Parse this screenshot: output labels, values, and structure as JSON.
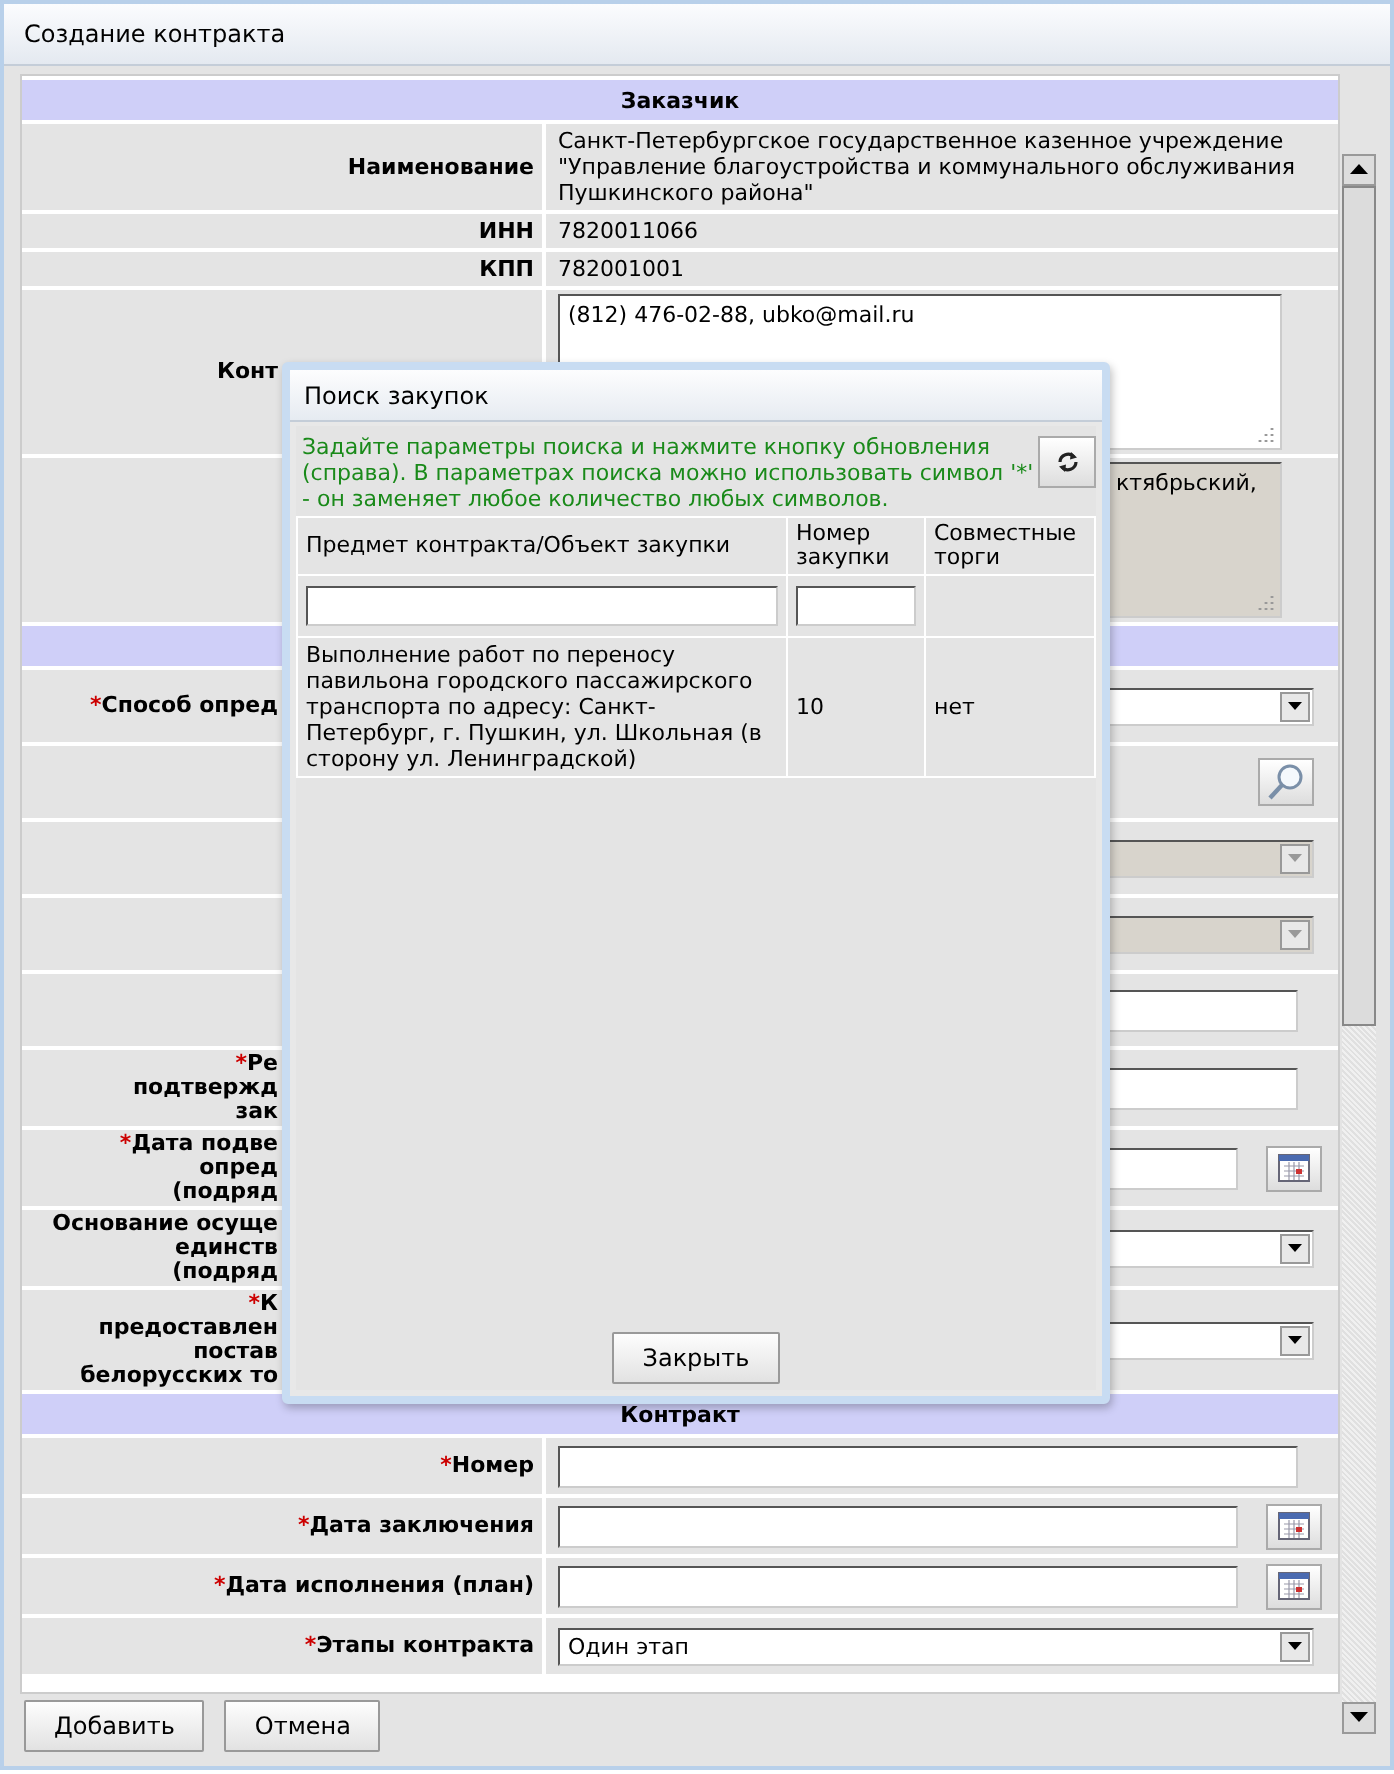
{
  "window": {
    "title": "Создание контракта"
  },
  "required_symbol": "*",
  "sections": [
    {
      "title": "Заказчик",
      "rows": [
        {
          "kind": "text",
          "label": "Наименование",
          "required": false,
          "value": "Санкт-Петербургское государственное казенное учреждение \"Управление благоустройства и коммунального обслуживания Пушкинского района\""
        },
        {
          "kind": "text",
          "label": "ИНН",
          "required": false,
          "value": "7820011066"
        },
        {
          "kind": "text",
          "label": "КПП",
          "required": false,
          "value": "782001001"
        },
        {
          "kind": "textarea",
          "label": "Конт",
          "required": false,
          "cut": true,
          "disabled": false,
          "value": "(812) 476-02-88, ubko@mail.ru"
        },
        {
          "kind": "textarea",
          "required": false,
          "cut": true,
          "disabled": true,
          "value": "ктябрьский,"
        }
      ]
    },
    {
      "rows": [
        {
          "kind": "select",
          "label": "Способ опред",
          "required": true,
          "cut": true,
          "disabled": false
        },
        {
          "kind": "search",
          "required": false
        },
        {
          "kind": "select",
          "required": false,
          "disabled": true
        },
        {
          "kind": "select",
          "required": false,
          "disabled": true
        },
        {
          "kind": "input",
          "required": false
        },
        {
          "kind": "input",
          "label": "Ре\nподтвержд\nзак",
          "required": true,
          "cut": true
        },
        {
          "kind": "date",
          "label": "Дата подве\nопред\n(подряд",
          "required": true,
          "cut": true
        },
        {
          "kind": "select",
          "label": "Основание осуще\nединств\n(подряд",
          "required": false,
          "cut": true,
          "disabled": false
        },
        {
          "kind": "select",
          "label": "К\nпредоставлен\nпостав\nбелорусских то",
          "required": true,
          "cut": true,
          "disabled": false
        }
      ]
    },
    {
      "title": "Контракт",
      "rows": [
        {
          "kind": "input",
          "label": "Номер",
          "required": true
        },
        {
          "kind": "date",
          "label": "Дата заключения",
          "required": true
        },
        {
          "kind": "date",
          "label": "Дата исполнения (план)",
          "required": true
        },
        {
          "kind": "select",
          "label": "Этапы контракта",
          "required": true,
          "disabled": false,
          "value": "Один этап"
        }
      ]
    }
  ],
  "footer_buttons": [
    "Добавить",
    "Отмена"
  ],
  "dialog": {
    "title": "Поиск закупок",
    "hint": "Задайте параметры поиска и нажмите кнопку обновления (справа). В параметрах поиска можно использовать символ '*' - он заменяет любое количество любых символов.",
    "columns": [
      {
        "label": "Предмет контракта/Объект закупки",
        "filter": true
      },
      {
        "label": "Номер закупки",
        "filter": true
      },
      {
        "label": "Совместные торги",
        "filter": false
      }
    ],
    "rows": [
      [
        "Выполнение работ по переносу павильона городского пассажирского транспорта по адресу: Санкт-Петербург, г. Пушкин, ул. Школьная (в сторону ул. Ленинградской)",
        "10",
        "нет"
      ]
    ],
    "close_button": "Закрыть"
  }
}
